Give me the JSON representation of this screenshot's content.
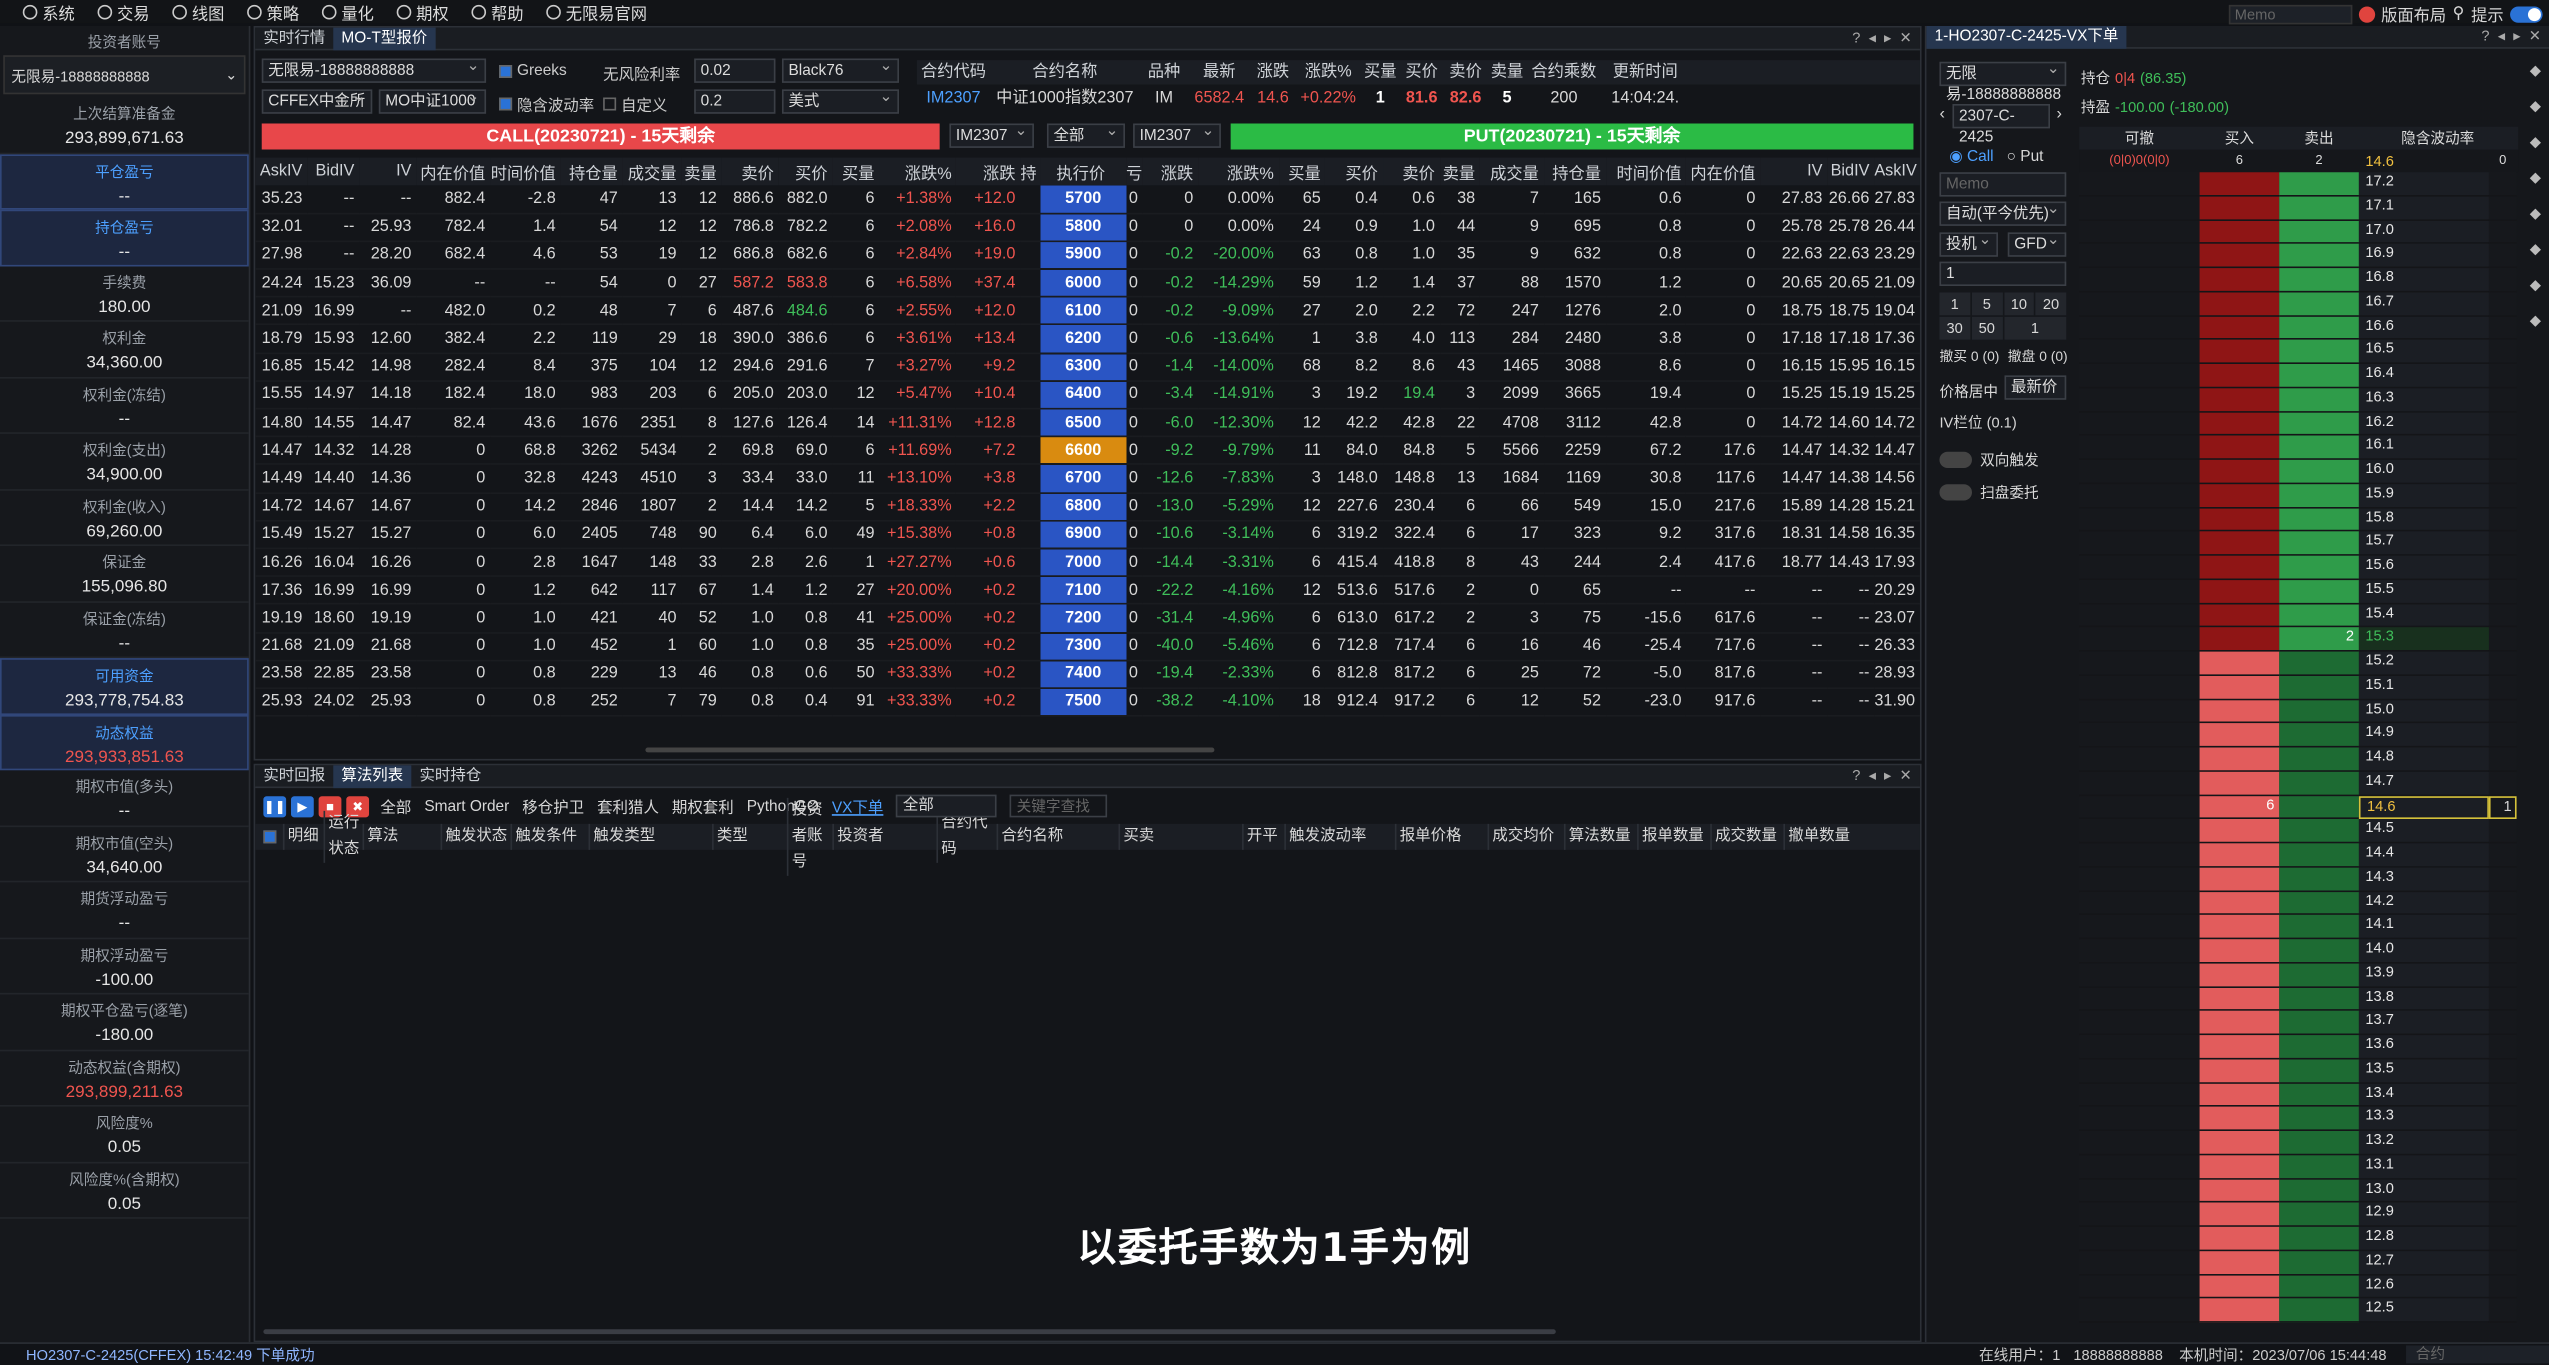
{
  "menu": [
    "系统",
    "交易",
    "线图",
    "策略",
    "量化",
    "期权",
    "帮助",
    "无限易官网"
  ],
  "top_right": {
    "memo": "Memo",
    "layout": "版面布局",
    "hint": "提示"
  },
  "left": {
    "account_label": "投资者账号",
    "account": "无限易-18888888888",
    "rows": [
      {
        "k": "上次结算准备金",
        "v": "293,899,671.63"
      },
      {
        "k": "平仓盈亏",
        "v": "--",
        "hl": true
      },
      {
        "k": "持仓盈亏",
        "v": "--",
        "hl": true
      },
      {
        "k": "手续费",
        "v": "180.00"
      },
      {
        "k": "权利金",
        "v": "34,360.00"
      },
      {
        "k": "权利金(冻结)",
        "v": "--"
      },
      {
        "k": "权利金(支出)",
        "v": "34,900.00"
      },
      {
        "k": "权利金(收入)",
        "v": "69,260.00"
      },
      {
        "k": "保证金",
        "v": "155,096.80"
      },
      {
        "k": "保证金(冻结)",
        "v": "--"
      },
      {
        "k": "可用资金",
        "v": "293,778,754.83",
        "hl": true
      },
      {
        "k": "动态权益",
        "v": "293,933,851.63",
        "hl": true,
        "red": true
      },
      {
        "k": "期权市值(多头)",
        "v": "--"
      },
      {
        "k": "期权市值(空头)",
        "v": "34,640.00"
      },
      {
        "k": "期货浮动盈亏",
        "v": "--"
      },
      {
        "k": "期权浮动盈亏",
        "v": "-100.00"
      },
      {
        "k": "期权平仓盈亏(逐笔)",
        "v": "-180.00"
      },
      {
        "k": "动态权益(含期权)",
        "v": "293,899,211.63",
        "red": true
      },
      {
        "k": "风险度%",
        "v": "0.05"
      },
      {
        "k": "风险度%(含期权)",
        "v": "0.05"
      }
    ]
  },
  "main": {
    "tabs": [
      "实时行情",
      "MO-T型报价"
    ],
    "account": "无限易-18888888888",
    "greeks": "Greeks",
    "rf_label": "无风险利率",
    "rf": "0.02",
    "model": "Black76",
    "exchange": "CFFEX中金所",
    "product": "MO中证1000",
    "iv_label": "隐含波动率",
    "custom": "自定义",
    "iv_val": "0.2",
    "style": "美式",
    "quote_headers": [
      "合约代码",
      "合约名称",
      "品种",
      "最新",
      "涨跌",
      "涨跌%",
      "买量",
      "买价",
      "卖价",
      "卖量",
      "合约乘数",
      "更新时间"
    ],
    "quote": [
      "IM2307",
      "中证1000指数2307",
      "IM",
      "6582.4",
      "14.6",
      "+0.22%",
      "1",
      "81.6",
      "82.6",
      "5",
      "200",
      "14:04:24."
    ],
    "call_title": "CALL(20230721) - 15天剩余",
    "put_title": "PUT(20230721) - 15天剩余",
    "sel1": "IM2307",
    "sel2": "全部",
    "sel3": "IM2307",
    "call_cols": [
      "AskIV",
      "BidIV",
      "IV",
      "内在价值",
      "时间价值",
      "持仓量",
      "成交量",
      "卖量",
      "卖价",
      "买价",
      "买量",
      "涨跌%",
      "涨跌",
      "持"
    ],
    "strike_col": "执行价",
    "put_cols": [
      "亏",
      "涨跌",
      "涨跌%",
      "买量",
      "买价",
      "卖价",
      "卖量",
      "成交量",
      "持仓量",
      "时间价值",
      "内在价值",
      "IV",
      "BidIV",
      "AskIV"
    ],
    "rows": [
      {
        "c": [
          "35.23",
          "--",
          "--",
          "882.4",
          "-2.8",
          "47",
          "13",
          "12",
          "886.6",
          "882.0",
          "6",
          "+1.38%",
          "+12.0"
        ],
        "k": "5700",
        "p": [
          "0",
          "0",
          "0.00%",
          "65",
          "0.4",
          "0.6",
          "38",
          "7",
          "165",
          "0.6",
          "0",
          "27.83",
          "26.66",
          "27.83"
        ]
      },
      {
        "c": [
          "32.01",
          "--",
          "25.93",
          "782.4",
          "1.4",
          "54",
          "12",
          "12",
          "786.8",
          "782.2",
          "6",
          "+2.08%",
          "+16.0"
        ],
        "k": "5800",
        "p": [
          "0",
          "0",
          "0.00%",
          "24",
          "0.9",
          "1.0",
          "44",
          "9",
          "695",
          "0.8",
          "0",
          "25.78",
          "25.78",
          "26.44"
        ]
      },
      {
        "c": [
          "27.98",
          "--",
          "28.20",
          "682.4",
          "4.6",
          "53",
          "19",
          "12",
          "686.8",
          "682.6",
          "6",
          "+2.84%",
          "+19.0"
        ],
        "k": "5900",
        "p": [
          "0",
          "-0.2",
          "-20.00%",
          "63",
          "0.8",
          "1.0",
          "35",
          "9",
          "632",
          "0.8",
          "0",
          "22.63",
          "22.63",
          "23.29"
        ]
      },
      {
        "c": [
          "24.24",
          "15.23",
          "36.09",
          "--",
          "--",
          "54",
          "0",
          "27",
          "587.2",
          "583.8",
          "6",
          "+6.58%",
          "+37.4"
        ],
        "k": "6000",
        "p": [
          "0",
          "-0.2",
          "-14.29%",
          "59",
          "1.2",
          "1.4",
          "37",
          "88",
          "1570",
          "1.2",
          "0",
          "20.65",
          "20.65",
          "21.09"
        ]
      },
      {
        "c": [
          "21.09",
          "16.99",
          "--",
          "482.0",
          "0.2",
          "48",
          "7",
          "6",
          "487.6",
          "484.6",
          "6",
          "+2.55%",
          "+12.0"
        ],
        "k": "6100",
        "p": [
          "0",
          "-0.2",
          "-9.09%",
          "27",
          "2.0",
          "2.2",
          "72",
          "247",
          "1276",
          "2.0",
          "0",
          "18.75",
          "18.75",
          "19.04"
        ]
      },
      {
        "c": [
          "18.79",
          "15.93",
          "12.60",
          "382.4",
          "2.2",
          "119",
          "29",
          "18",
          "390.0",
          "386.6",
          "6",
          "+3.61%",
          "+13.4"
        ],
        "k": "6200",
        "p": [
          "0",
          "-0.6",
          "-13.64%",
          "1",
          "3.8",
          "4.0",
          "113",
          "284",
          "2480",
          "3.8",
          "0",
          "17.18",
          "17.18",
          "17.36"
        ]
      },
      {
        "c": [
          "16.85",
          "15.42",
          "14.98",
          "282.4",
          "8.4",
          "375",
          "104",
          "12",
          "294.6",
          "291.6",
          "7",
          "+3.27%",
          "+9.2"
        ],
        "k": "6300",
        "p": [
          "0",
          "-1.4",
          "-14.00%",
          "68",
          "8.2",
          "8.6",
          "43",
          "1465",
          "3088",
          "8.6",
          "0",
          "16.15",
          "15.95",
          "16.15"
        ]
      },
      {
        "c": [
          "15.55",
          "14.97",
          "14.18",
          "182.4",
          "18.0",
          "983",
          "203",
          "6",
          "205.0",
          "203.0",
          "12",
          "+5.47%",
          "+10.4"
        ],
        "k": "6400",
        "p": [
          "0",
          "-3.4",
          "-14.91%",
          "3",
          "19.2",
          "19.4",
          "3",
          "2099",
          "3665",
          "19.4",
          "0",
          "15.25",
          "15.19",
          "15.25"
        ]
      },
      {
        "c": [
          "14.80",
          "14.55",
          "14.47",
          "82.4",
          "43.6",
          "1676",
          "2351",
          "8",
          "127.6",
          "126.4",
          "14",
          "+11.31%",
          "+12.8"
        ],
        "k": "6500",
        "p": [
          "0",
          "-6.0",
          "-12.30%",
          "12",
          "42.2",
          "42.8",
          "22",
          "4708",
          "3112",
          "42.8",
          "0",
          "14.72",
          "14.60",
          "14.72"
        ]
      },
      {
        "c": [
          "14.47",
          "14.32",
          "14.28",
          "0",
          "68.8",
          "3262",
          "5434",
          "2",
          "69.8",
          "69.0",
          "6",
          "+11.69%",
          "+7.2"
        ],
        "k": "6600",
        "atm": true,
        "p": [
          "0",
          "-9.2",
          "-9.79%",
          "11",
          "84.0",
          "84.8",
          "5",
          "5566",
          "2259",
          "67.2",
          "17.6",
          "14.47",
          "14.32",
          "14.47"
        ]
      },
      {
        "c": [
          "14.49",
          "14.40",
          "14.36",
          "0",
          "32.8",
          "4243",
          "4510",
          "3",
          "33.4",
          "33.0",
          "11",
          "+13.10%",
          "+3.8"
        ],
        "k": "6700",
        "p": [
          "0",
          "-12.6",
          "-7.83%",
          "3",
          "148.0",
          "148.8",
          "13",
          "1684",
          "1169",
          "30.8",
          "117.6",
          "14.47",
          "14.38",
          "14.56"
        ]
      },
      {
        "c": [
          "14.72",
          "14.67",
          "14.67",
          "0",
          "14.2",
          "2846",
          "1807",
          "2",
          "14.4",
          "14.2",
          "5",
          "+18.33%",
          "+2.2"
        ],
        "k": "6800",
        "p": [
          "0",
          "-13.0",
          "-5.29%",
          "12",
          "227.6",
          "230.4",
          "6",
          "66",
          "549",
          "15.0",
          "217.6",
          "15.89",
          "14.28",
          "15.21"
        ]
      },
      {
        "c": [
          "15.49",
          "15.27",
          "15.27",
          "0",
          "6.0",
          "2405",
          "748",
          "90",
          "6.4",
          "6.0",
          "49",
          "+15.38%",
          "+0.8"
        ],
        "k": "6900",
        "p": [
          "0",
          "-10.6",
          "-3.14%",
          "6",
          "319.2",
          "322.4",
          "6",
          "17",
          "323",
          "9.2",
          "317.6",
          "18.31",
          "14.58",
          "16.35"
        ]
      },
      {
        "c": [
          "16.26",
          "16.04",
          "16.26",
          "0",
          "2.8",
          "1647",
          "148",
          "33",
          "2.8",
          "2.6",
          "1",
          "+27.27%",
          "+0.6"
        ],
        "k": "7000",
        "p": [
          "0",
          "-14.4",
          "-3.31%",
          "6",
          "415.4",
          "418.8",
          "8",
          "43",
          "244",
          "2.4",
          "417.6",
          "18.77",
          "14.43",
          "17.93"
        ]
      },
      {
        "c": [
          "17.36",
          "16.99",
          "16.99",
          "0",
          "1.2",
          "642",
          "117",
          "67",
          "1.4",
          "1.2",
          "27",
          "+20.00%",
          "+0.2"
        ],
        "k": "7100",
        "p": [
          "0",
          "-22.2",
          "-4.16%",
          "12",
          "513.6",
          "517.6",
          "2",
          "0",
          "65",
          "--",
          "--",
          "--",
          "--",
          "20.29"
        ]
      },
      {
        "c": [
          "19.19",
          "18.60",
          "19.19",
          "0",
          "1.0",
          "421",
          "40",
          "52",
          "1.0",
          "0.8",
          "41",
          "+25.00%",
          "+0.2"
        ],
        "k": "7200",
        "p": [
          "0",
          "-31.4",
          "-4.96%",
          "6",
          "613.0",
          "617.2",
          "2",
          "3",
          "75",
          "-15.6",
          "617.6",
          "--",
          "--",
          "23.07"
        ]
      },
      {
        "c": [
          "21.68",
          "21.09",
          "21.68",
          "0",
          "1.0",
          "452",
          "1",
          "60",
          "1.0",
          "0.8",
          "35",
          "+25.00%",
          "+0.2"
        ],
        "k": "7300",
        "p": [
          "0",
          "-40.0",
          "-5.46%",
          "6",
          "712.8",
          "717.4",
          "6",
          "16",
          "46",
          "-25.4",
          "717.6",
          "--",
          "--",
          "26.33"
        ]
      },
      {
        "c": [
          "23.58",
          "22.85",
          "23.58",
          "0",
          "0.8",
          "229",
          "13",
          "46",
          "0.8",
          "0.6",
          "50",
          "+33.33%",
          "+0.2"
        ],
        "k": "7400",
        "p": [
          "0",
          "-19.4",
          "-2.33%",
          "6",
          "812.8",
          "817.2",
          "6",
          "25",
          "72",
          "-5.0",
          "817.6",
          "--",
          "--",
          "28.93"
        ]
      },
      {
        "c": [
          "25.93",
          "24.02",
          "25.93",
          "0",
          "0.8",
          "252",
          "7",
          "79",
          "0.8",
          "0.4",
          "91",
          "+33.33%",
          "+0.2"
        ],
        "k": "7500",
        "p": [
          "0",
          "-38.2",
          "-4.10%",
          "18",
          "912.4",
          "917.2",
          "6",
          "12",
          "52",
          "-23.0",
          "917.6",
          "--",
          "--",
          "31.90"
        ]
      }
    ]
  },
  "bottom": {
    "tabs": [
      "实时回报",
      "算法列表",
      "实时持仓"
    ],
    "filters": [
      "全部",
      "Smart Order",
      "移仓护卫",
      "套利猎人",
      "期权套利",
      "PythonGO",
      "VX下单"
    ],
    "filter_sel": "全部",
    "search_placeholder": "关键字查找",
    "cols": [
      "明细",
      "运行状态",
      "算法",
      "触发状态",
      "触发条件",
      "触发类型",
      "类型",
      "投资者账号",
      "投资者",
      "合约代码",
      "合约名称",
      "买卖",
      "开平",
      "触发波动率",
      "报单价格",
      "成交均价",
      "算法数量",
      "报单数量",
      "成交数量",
      "撤单数量"
    ]
  },
  "subtitle": "以委托手数为1手为例",
  "right": {
    "title": "1-HO2307-C-2425-VX下单",
    "account": "无限易-18888888888",
    "contract": "2307-C-2425",
    "pos_label": "持仓",
    "pos_val": "0|4",
    "pos_pnl": "(86.35)",
    "hold_label": "持盈",
    "hold_val": "-100.00",
    "hold_pnl": "(-180.00)",
    "call": "Call",
    "put": "Put",
    "memo": "Memo",
    "auto": "自动(平今优先)",
    "spec": "投机",
    "gfd": "GFD",
    "qty": "1",
    "qty_btns": [
      "1",
      "5",
      "10",
      "20",
      "30",
      "50"
    ],
    "step": "1",
    "cancel_buy": "撤买 0 (0)",
    "cancel_all": "撤盘 0 (0)",
    "price_mid_label": "价格居中",
    "price_mid": "最新价",
    "iv_label": "IV栏位 (0.1)",
    "dual": "双向触发",
    "sweep": "扫盘委托",
    "ladder_headers": [
      "可撤",
      "买入",
      "卖出",
      "隐含波动率"
    ],
    "top_row": {
      "left": "(0|0)0(0|0)",
      "buy": "6",
      "sell": "2",
      "iv": "14.6",
      "right": "0"
    },
    "ivs": [
      "17.2",
      "17.1",
      "17.0",
      "16.9",
      "16.8",
      "16.7",
      "16.6",
      "16.5",
      "16.4",
      "16.3",
      "16.2",
      "16.1",
      "16.0",
      "15.9",
      "15.8",
      "15.7",
      "15.6",
      "15.5",
      "15.4",
      "15.3",
      "15.2",
      "15.1",
      "15.0",
      "14.9",
      "14.8",
      "14.7",
      "14.6",
      "14.5",
      "14.4",
      "14.3",
      "14.2",
      "14.1",
      "14.0",
      "13.9",
      "13.8",
      "13.7",
      "13.6",
      "13.5",
      "13.4",
      "13.3",
      "13.2",
      "13.1",
      "13.0",
      "12.9",
      "12.8",
      "12.7",
      "12.6",
      "12.5"
    ],
    "sell_mark": {
      "iv": "15.3",
      "qty": "2"
    },
    "buy_mark": {
      "iv": "14.6",
      "qty": "6",
      "right": "1"
    }
  },
  "status": {
    "left": "HO2307-C-2425(CFFEX)  15:42:49  下单成功",
    "online": "在线用户：1",
    "user": "18888888888",
    "time": "本机时间：2023/07/06  15:44:48",
    "contract_ph": "合约"
  }
}
